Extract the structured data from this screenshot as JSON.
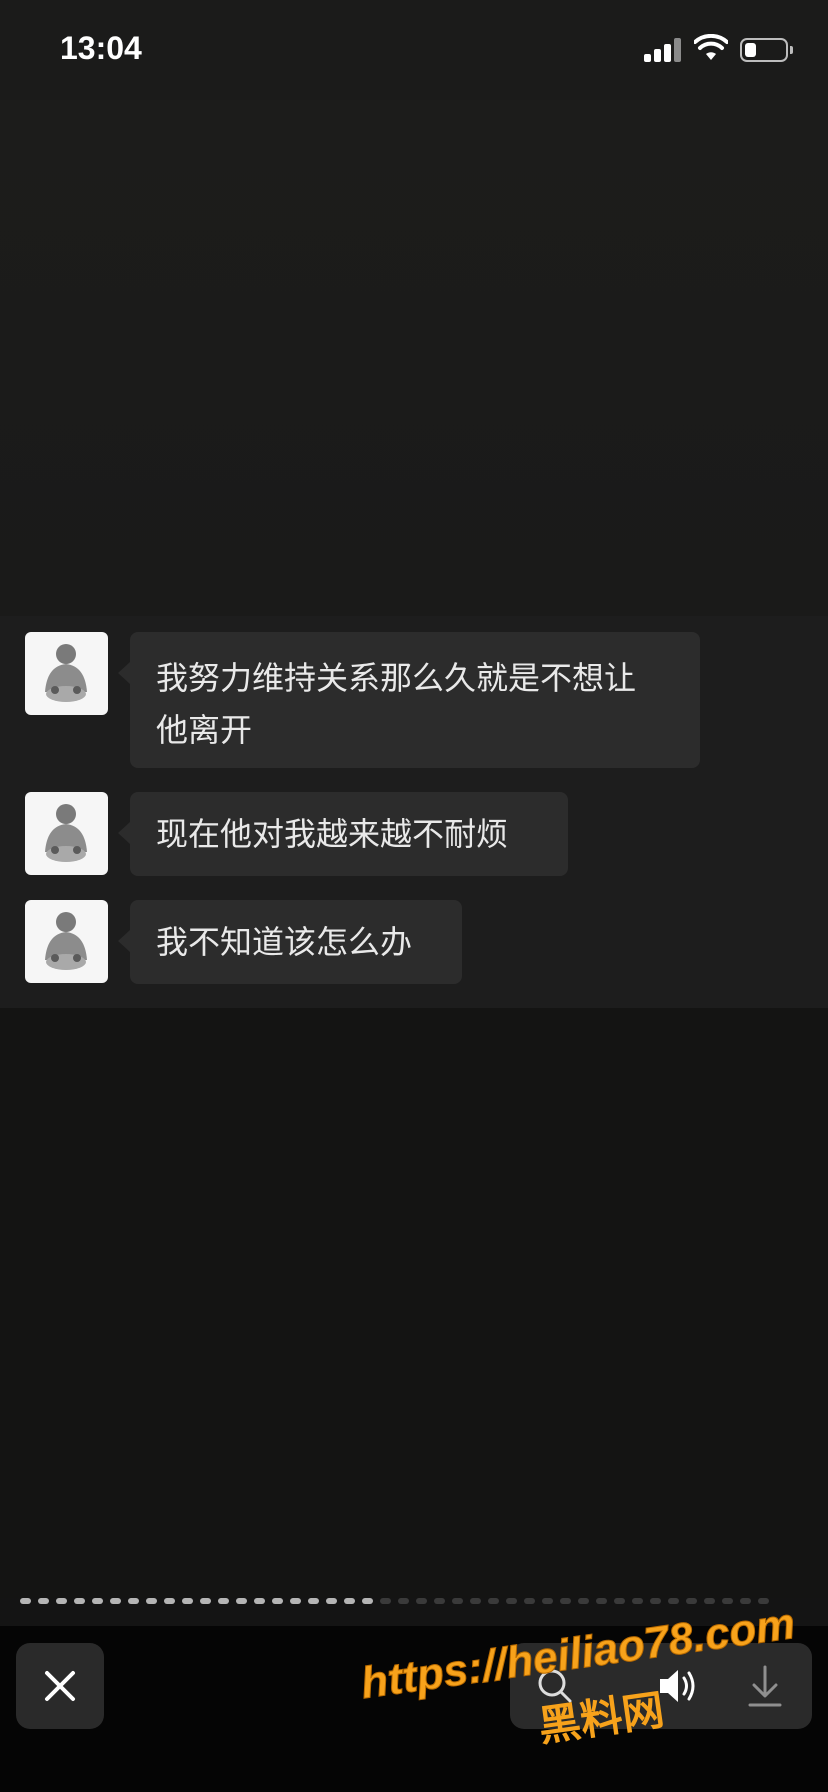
{
  "status_bar": {
    "time": "13:04",
    "icons": [
      "signal-icon",
      "wifi-icon",
      "battery-icon"
    ]
  },
  "chat": {
    "messages": [
      {
        "text": "我努力维持关系那么久就是不想让他离开",
        "lines": [
          "我努力维持关系那么久就是不想让",
          "他离开"
        ]
      },
      {
        "text": "现在他对我越来越不耐烦"
      },
      {
        "text": "我不知道该怎么办"
      }
    ]
  },
  "player": {
    "progress": 0.47,
    "segments_total": 42,
    "buttons": [
      "close-icon",
      "search-icon",
      "speaker-icon",
      "download-icon"
    ]
  },
  "watermark": {
    "url": "https://heiliao78.com",
    "name": "黑料网"
  },
  "colors": {
    "background": "#141414",
    "chat_panel": "#1d1d1d",
    "bubble": "#2c2c2c",
    "watermark": "#f7a21b"
  }
}
